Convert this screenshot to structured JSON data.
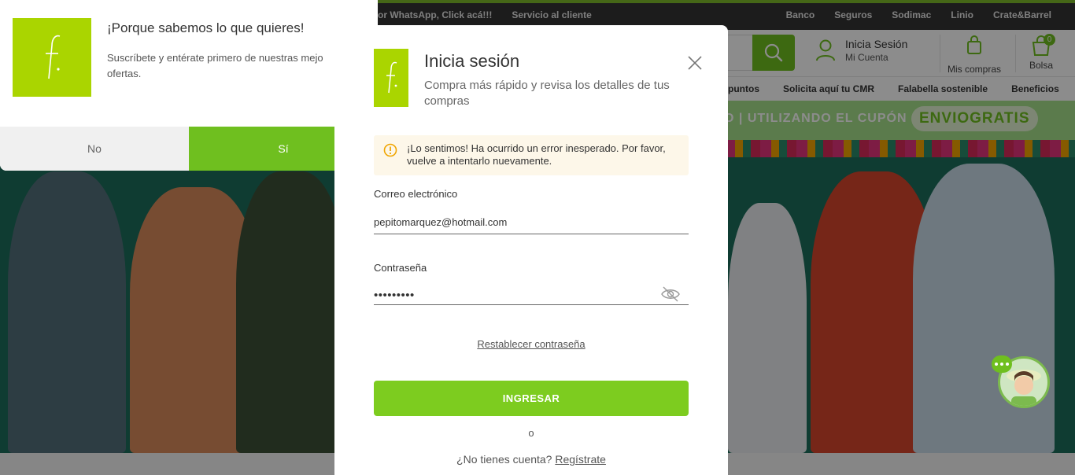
{
  "topbar": {
    "left_links": [
      "or WhatsApp, Click acá!!!",
      "Servicio al cliente"
    ],
    "right_links": [
      "Banco",
      "Seguros",
      "Sodimac",
      "Linio",
      "Crate&Barrel"
    ]
  },
  "header": {
    "account_line1": "Inicia Sesión",
    "account_line2": "Mi Cuenta",
    "purchases_label": "Mis compras",
    "bag_label": "Bolsa",
    "bag_count": "0"
  },
  "navbar": {
    "items": [
      "puntos",
      "Solicita aquí tu CMR",
      "Falabella sostenible",
      "Beneficios"
    ]
  },
  "promo": {
    "text": "O | UTILIZANDO EL CUPÓN",
    "coupon": "ENVIOGRATIS"
  },
  "notification": {
    "title": "¡Porque sabemos lo que quieres!",
    "body_line1": "Suscríbete y entérate primero de nuestras mejo",
    "body_line2": "ofertas.",
    "no_label": "No",
    "yes_label": "Sí"
  },
  "login": {
    "title": "Inicia sesión",
    "subtitle": "Compra más rápido y revisa los detalles de tus compras",
    "error_message": "¡Lo sentimos! Ha ocurrido un error inesperado. Por favor, vuelve a intentarlo nuevamente.",
    "email_label": "Correo electrónico",
    "email_value": "pepitomarquez@hotmail.com",
    "password_label": "Contraseña",
    "password_mask": "•••••••••",
    "reset_link": "Restablecer contraseña",
    "submit_label": "INGRESAR",
    "or_text": "o",
    "no_account_text": "¿No tienes cuenta?",
    "register_link": "Regístrate"
  },
  "colors": {
    "brand_green": "#aad500",
    "button_green": "#7dcc1f",
    "error_bg": "#fdf7e9",
    "warning_icon": "#f0a500"
  },
  "icons": [
    "falabella-logo",
    "close-icon",
    "warning-icon",
    "eye-off-icon",
    "search-icon",
    "user-icon",
    "shopping-bag-icon",
    "cart-icon",
    "chat-icon"
  ]
}
